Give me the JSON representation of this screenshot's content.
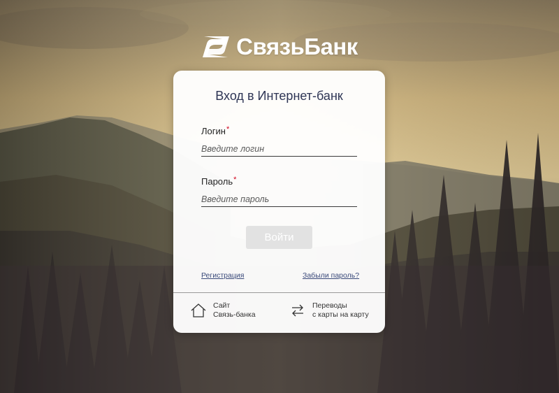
{
  "brand": {
    "name": "СвязьБанк",
    "logo_icon": "svyazbank-logo-icon"
  },
  "login_form": {
    "title": "Вход в Интернет-банк",
    "login_label": "Логин",
    "login_placeholder": "Введите логин",
    "password_label": "Пароль",
    "password_placeholder": "Введите пароль",
    "required_mark": "*",
    "submit_label": "Войти",
    "register_link": "Регистрация",
    "forgot_link": "Забыли пароль?"
  },
  "footer": {
    "site_line1": "Сайт",
    "site_line2": "Связь-банка",
    "site_icon": "home-icon",
    "transfer_line1": "Переводы",
    "transfer_line2": "с карты на карту",
    "transfer_icon": "transfer-arrows-icon"
  },
  "colors": {
    "title": "#2e3555",
    "required": "#d0021b",
    "button_disabled": "#e2e2e2",
    "link": "#3a4a7a"
  }
}
